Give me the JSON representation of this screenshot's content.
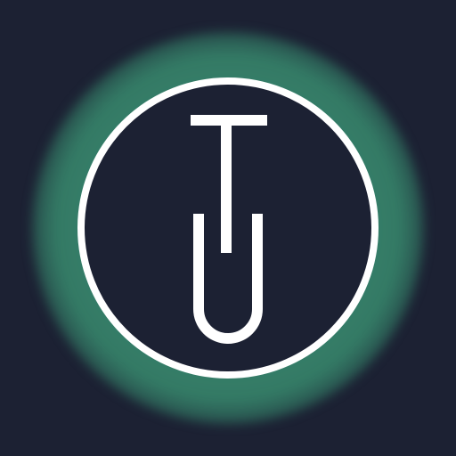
{
  "logo": {
    "name": "TU monogram",
    "letters": "TU",
    "colors": {
      "background": "#1c2133",
      "glow": "#3f9575",
      "ring": "#ffffff",
      "letters": "#ffffff"
    }
  }
}
